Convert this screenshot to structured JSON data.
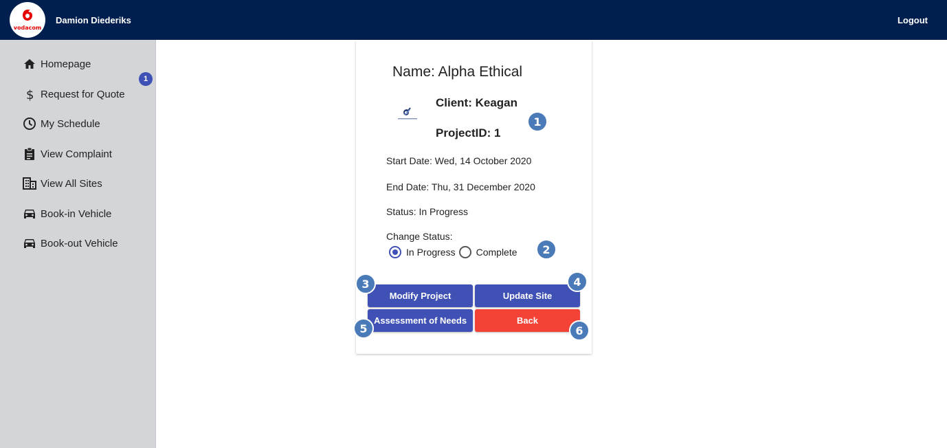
{
  "header": {
    "logo_text": "vodacom",
    "username": "Damion Diederiks",
    "logout_label": "Logout"
  },
  "sidebar": {
    "badge": "1",
    "items": [
      {
        "label": "Homepage",
        "icon": "home-icon"
      },
      {
        "label": "Request for Quote",
        "icon": "dollar-icon"
      },
      {
        "label": "My Schedule",
        "icon": "clock-icon"
      },
      {
        "label": "View Complaint",
        "icon": "clipboard-icon"
      },
      {
        "label": "View All Sites",
        "icon": "building-icon"
      },
      {
        "label": "Book-in Vehicle",
        "icon": "car-icon"
      },
      {
        "label": "Book-out Vehicle",
        "icon": "car-icon"
      }
    ]
  },
  "project": {
    "name_line": "Name: Alpha Ethical",
    "client_line": "Client: Keagan",
    "projectid_line": "ProjectID: 1",
    "start_line": "Start Date: Wed, 14 October 2020",
    "end_line": "End Date: Thu, 31 December 2020",
    "status_line": "Status: In Progress",
    "change_status_label": "Change Status:",
    "status_options": [
      "In Progress",
      "Complete"
    ],
    "selected_status": "In Progress"
  },
  "buttons": {
    "modify": "Modify Project",
    "update_site": "Update Site",
    "assessment": "Assessment of Needs",
    "back": "Back"
  },
  "annotations": [
    "1",
    "2",
    "3",
    "4",
    "5",
    "6"
  ],
  "colors": {
    "topbar": "#001e4e",
    "sidebar": "#d3d5d8",
    "primary": "#3f51b5",
    "danger": "#f44336",
    "annotation": "#4a7ab8"
  }
}
